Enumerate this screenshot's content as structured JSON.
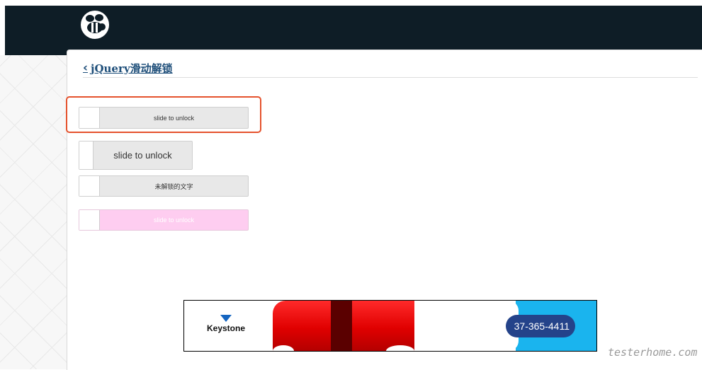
{
  "header": {
    "logo_icon": "bee-logo-icon"
  },
  "page": {
    "back_icon": "chevron-left-icon",
    "title": "jQuery滑动解锁"
  },
  "sliders": [
    {
      "label": "slide to unlock"
    },
    {
      "label": "slide to unlock"
    },
    {
      "label": "未解锁的文字"
    },
    {
      "label": "slide to unlock"
    }
  ],
  "ad": {
    "brand": "Keystone",
    "phone": "37-365-4411"
  },
  "watermark": "testerhome.com",
  "colors": {
    "highlight": "#e5522d",
    "pink_slider": "#fecdf0",
    "topbar": "#0e1d26",
    "ad_blue": "#1ab4ee"
  }
}
